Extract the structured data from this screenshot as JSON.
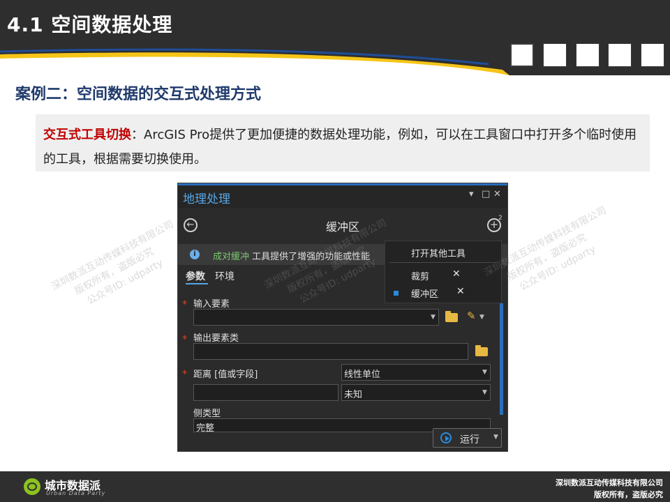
{
  "header": {
    "title": "4.1 空间数据处理",
    "squares": 5
  },
  "section": {
    "title": "案例二：空间数据的交互式处理方式"
  },
  "note": {
    "keyword": "交互式工具切换",
    "text": "：ArcGIS Pro提供了更加便捷的数据处理功能，例如，可以在工具窗口中打开多个临时使用的工具，根据需要切换使用。"
  },
  "gp_pane": {
    "title": "地理处理",
    "controls": {
      "menu": "▾",
      "maximize": "□",
      "close": "✕"
    },
    "tool_name": "缓冲区",
    "add_badge": "2",
    "info": {
      "link": "成对缓冲",
      "text": " 工具提供了增强的功能或性能"
    },
    "tabs": [
      "参数",
      "环境"
    ],
    "params": {
      "input_label": "输入要素",
      "output_label": "输出要素类",
      "distance_label": "距离 [值或字段]",
      "unit_type": "线性单位",
      "unit_value": "未知",
      "side_label": "侧类型",
      "side_value": "完整"
    },
    "popup": {
      "open_other": "打开其他工具",
      "items": [
        {
          "label": "裁剪",
          "selected": false
        },
        {
          "label": "缓冲区",
          "selected": true
        }
      ],
      "close_glyph": "✕"
    },
    "run_label": "运行"
  },
  "watermark": {
    "line1": "深圳数派互动传媒科技有限公司",
    "line2": "版权所有，盗版必究",
    "line3": "公众号ID: udparty"
  },
  "footer": {
    "logo_text": "城市数据派",
    "logo_sub": "Urban Data Party",
    "company": "深圳数派互动传媒科技有限公司",
    "rights": "版权所有，盗版必究"
  },
  "colors": {
    "brand_yellow": "#f5c518",
    "brand_blue": "#1f3a6b",
    "accent_red": "#c00000",
    "gp_blue": "#2a6ebb",
    "logo_green": "#8dc21f"
  }
}
